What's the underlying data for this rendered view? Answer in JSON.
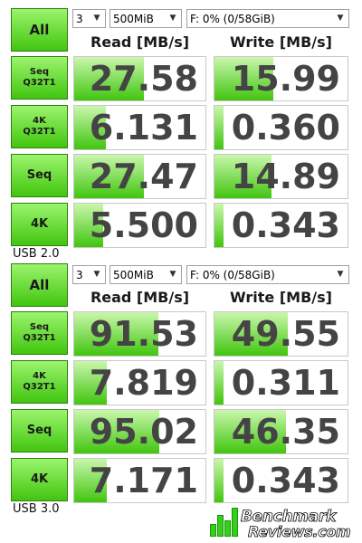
{
  "panels": [
    {
      "controls": {
        "all_label": "All",
        "count": "3",
        "size": "500MiB",
        "drive": "F: 0% (0/58GiB)"
      },
      "headers": {
        "read": "Read [MB/s]",
        "write": "Write [MB/s]"
      },
      "rows": [
        {
          "label_line1": "Seq",
          "label_line2": "Q32T1",
          "read": "27.58",
          "write": "15.99",
          "read_fill": 0.53,
          "write_fill": 0.44
        },
        {
          "label_line1": "4K",
          "label_line2": "Q32T1",
          "read": "6.131",
          "write": "0.360",
          "read_fill": 0.24,
          "write_fill": 0.07
        },
        {
          "label_line1": "Seq",
          "label_line2": "",
          "read": "27.47",
          "write": "14.89",
          "read_fill": 0.53,
          "write_fill": 0.43
        },
        {
          "label_line1": "4K",
          "label_line2": "",
          "read": "5.500",
          "write": "0.343",
          "read_fill": 0.22,
          "write_fill": 0.07
        }
      ],
      "footer": "USB 2.0"
    },
    {
      "controls": {
        "all_label": "All",
        "count": "3",
        "size": "500MiB",
        "drive": "F: 0% (0/58GiB)"
      },
      "headers": {
        "read": "Read [MB/s]",
        "write": "Write [MB/s]"
      },
      "rows": [
        {
          "label_line1": "Seq",
          "label_line2": "Q32T1",
          "read": "91.53",
          "write": "49.55",
          "read_fill": 0.64,
          "write_fill": 0.55
        },
        {
          "label_line1": "4K",
          "label_line2": "Q32T1",
          "read": "7.819",
          "write": "0.311",
          "read_fill": 0.25,
          "write_fill": 0.07
        },
        {
          "label_line1": "Seq",
          "label_line2": "",
          "read": "95.02",
          "write": "46.35",
          "read_fill": 0.65,
          "write_fill": 0.54
        },
        {
          "label_line1": "4K",
          "label_line2": "",
          "read": "7.171",
          "write": "0.343",
          "read_fill": 0.25,
          "write_fill": 0.07
        }
      ],
      "footer": "USB 3.0"
    }
  ],
  "logo": {
    "line1": "Benchmark",
    "line2": "Reviews.com"
  },
  "icons": {
    "dropdown": "chevron-down-icon",
    "logo": "benchmark-bars-icon"
  },
  "colors": {
    "accent": "#41c50f",
    "accent_light": "#9cf46e",
    "value_text": "#444444"
  }
}
